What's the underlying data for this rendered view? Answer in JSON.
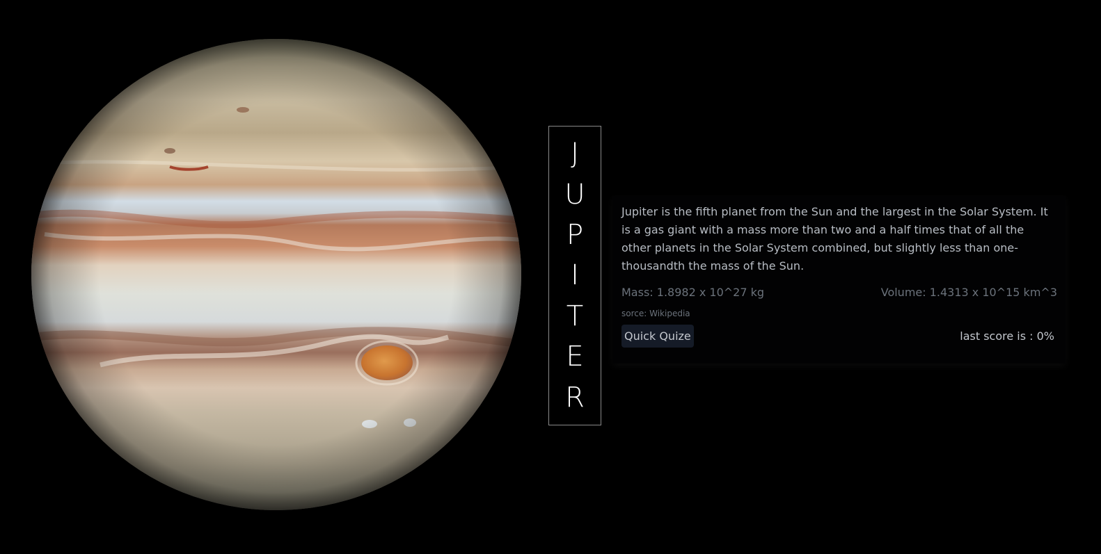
{
  "planet": {
    "name_letters": [
      "J",
      "U",
      "P",
      "I",
      "T",
      "E",
      "R"
    ],
    "image_icon": "jupiter-planet-image"
  },
  "info": {
    "description": "Jupiter is the fifth planet from the Sun and the largest in the Solar System. It is a gas giant with a mass more than two and a half times that of all the other planets in the Solar System combined, but slightly less than one-thousandth the mass of the Sun.",
    "mass": "Mass: 1.8982 x 10^27 kg",
    "volume": "Volume: 1.4313 x 10^15 km^3",
    "source": "sorce: Wikipedia",
    "quiz_button_label": "Quick Quize",
    "last_score": "last score is : 0%"
  },
  "colors": {
    "background": "#000000",
    "text_primary": "#b8bdc4",
    "text_muted": "#6b727b",
    "button_bg": "#151b27",
    "name_border": "#8a8a8a"
  }
}
